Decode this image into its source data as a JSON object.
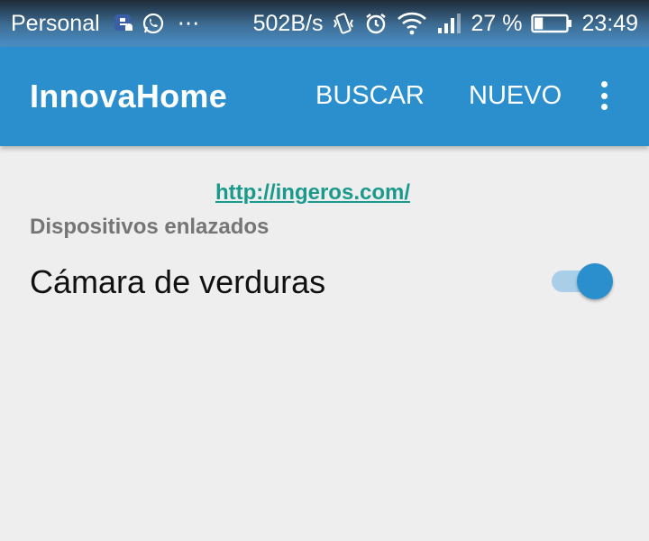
{
  "status_bar": {
    "carrier": "Personal",
    "more": "⋯",
    "speed": "502B/s",
    "battery_percent": "27 %",
    "time": "23:49",
    "icons": [
      "notification-icon",
      "whatsapp-icon",
      "vibrate-icon",
      "alarm-icon",
      "wifi-icon",
      "signal-icon",
      "battery-icon"
    ],
    "battery_level": 0.27
  },
  "app_bar": {
    "title": "InnovaHome",
    "buscar_label": "BUSCAR",
    "nuevo_label": "NUEVO",
    "background": "#2b8fce"
  },
  "content": {
    "link": "http://ingeros.com/",
    "section_header": "Dispositivos enlazados",
    "devices": [
      {
        "label": "Cámara de verduras",
        "enabled": true
      }
    ]
  },
  "colors": {
    "accent": "#2b8fce",
    "link": "#1a9a8c"
  }
}
